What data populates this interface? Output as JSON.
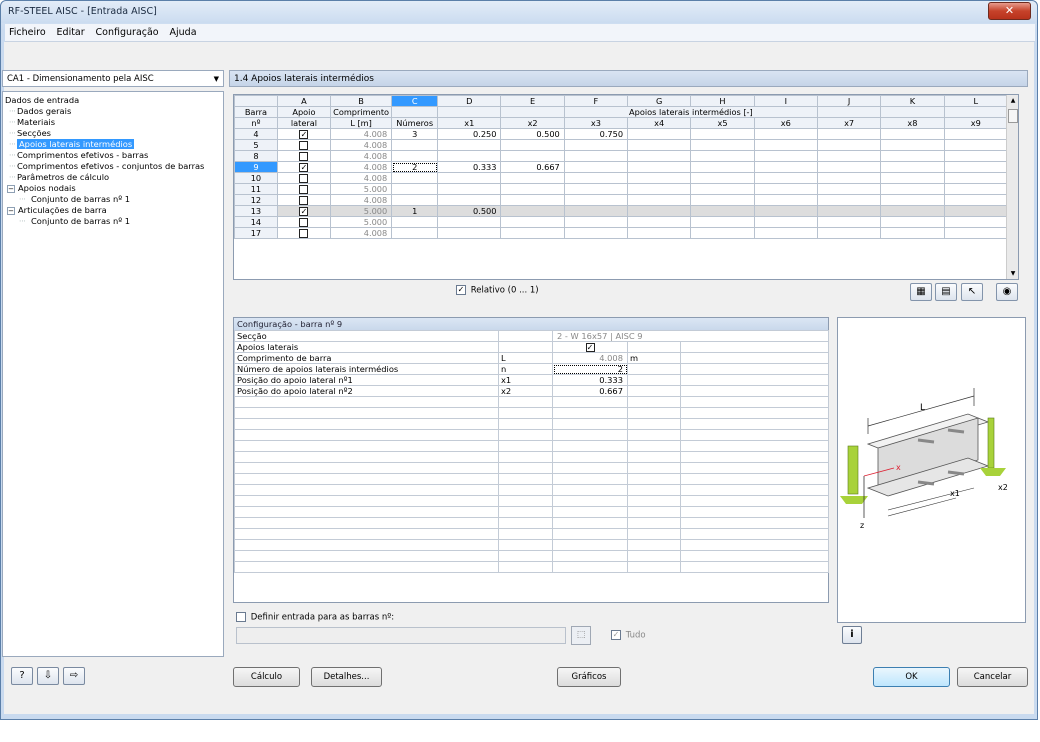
{
  "window": {
    "title": "RF-STEEL AISC - [Entrada AISC]",
    "close_glyph": "✕"
  },
  "menu": [
    "Ficheiro",
    "Editar",
    "Configuração",
    "Ajuda"
  ],
  "nav": {
    "dropdown": "CA1 - Dimensionamento pela AISC",
    "root": "Dados de entrada",
    "items": [
      {
        "label": "Dados gerais"
      },
      {
        "label": "Materiais"
      },
      {
        "label": "Secções"
      },
      {
        "label": "Apoios laterais intermédios",
        "selected": true
      },
      {
        "label": "Comprimentos efetivos - barras"
      },
      {
        "label": "Comprimentos efetivos - conjuntos de barras"
      },
      {
        "label": "Parâmetros de cálculo"
      }
    ],
    "apoios_nodais": "Apoios nodais",
    "apoios_nodais_child": "Conjunto de barras nº 1",
    "articulacoes": "Articulações de barra",
    "articulacoes_child": "Conjunto de barras nº 1",
    "collapse_glyph": "−"
  },
  "section_title": "1.4 Apoios laterais intermédios",
  "grid": {
    "col_letters": [
      "A",
      "B",
      "C",
      "D",
      "E",
      "F",
      "G",
      "H",
      "I",
      "J",
      "K",
      "L"
    ],
    "h_barra": "Barra",
    "h_barra2": "nº",
    "h_apoio": "Apoio",
    "h_apoio2": "lateral",
    "h_comp": "Comprimento",
    "h_comp2": "L [m]",
    "h_numeros": "Números",
    "h_group": "Apoios laterais intermédios [-]",
    "x_labels": [
      "x1",
      "x2",
      "x3",
      "x4",
      "x5",
      "x6",
      "x7",
      "x8",
      "x9"
    ],
    "rows": [
      {
        "barra": "4",
        "checked": true,
        "len": "4.008",
        "num": "3",
        "x1": "0.250",
        "x2": "0.500",
        "x3": "0.750"
      },
      {
        "barra": "5",
        "checked": false,
        "len": "4.008",
        "num": "",
        "x1": "",
        "x2": "",
        "x3": ""
      },
      {
        "barra": "8",
        "checked": false,
        "len": "4.008",
        "num": "",
        "x1": "",
        "x2": "",
        "x3": ""
      },
      {
        "barra": "9",
        "checked": true,
        "len": "4.008",
        "num": "2",
        "x1": "0.333",
        "x2": "0.667",
        "x3": "",
        "selected": true
      },
      {
        "barra": "10",
        "checked": false,
        "len": "4.008",
        "num": "",
        "x1": "",
        "x2": "",
        "x3": ""
      },
      {
        "barra": "11",
        "checked": false,
        "len": "5.000",
        "num": "",
        "x1": "",
        "x2": "",
        "x3": ""
      },
      {
        "barra": "12",
        "checked": false,
        "len": "4.008",
        "num": "",
        "x1": "",
        "x2": "",
        "x3": ""
      },
      {
        "barra": "13",
        "checked": true,
        "len": "5.000",
        "num": "1",
        "x1": "0.500",
        "x2": "",
        "x3": "",
        "highlight": true
      },
      {
        "barra": "14",
        "checked": false,
        "len": "5.000",
        "num": "",
        "x1": "",
        "x2": "",
        "x3": ""
      },
      {
        "barra": "17",
        "checked": false,
        "len": "4.008",
        "num": "",
        "x1": "",
        "x2": "",
        "x3": ""
      }
    ]
  },
  "relative_label": "Relativo (0 ... 1)",
  "relative_checked": true,
  "settings": {
    "title": "Configuração - barra nº 9",
    "rows": [
      {
        "label": "Secção",
        "sym": "",
        "value": "2 - W 16x57 | AISC 9",
        "unit": "",
        "kind": "section"
      },
      {
        "label": "Apoios laterais",
        "sym": "",
        "value": "☑",
        "unit": "",
        "kind": "check"
      },
      {
        "label": "Comprimento de barra",
        "sym": "L",
        "value": "4.008",
        "unit": "m",
        "kind": "grey"
      },
      {
        "label": "Número de apoios laterais intermédios",
        "sym": "n",
        "value": "2",
        "unit": "",
        "kind": "dotted"
      },
      {
        "label": "Posição do apoio lateral nº1",
        "sym": "x1",
        "value": "0.333",
        "unit": "",
        "kind": "val"
      },
      {
        "label": "Posição do apoio lateral nº2",
        "sym": "x2",
        "value": "0.667",
        "unit": "",
        "kind": "val"
      }
    ]
  },
  "define_label": "Definir entrada para as barras nº:",
  "tudo_label": "Tudo",
  "diagram": {
    "L": "L",
    "x": "x",
    "z": "z",
    "x1": "x1",
    "x2": "x2"
  },
  "buttons": {
    "calculo": "Cálculo",
    "detalhes": "Detalhes...",
    "graficos": "Gráficos",
    "ok": "OK",
    "cancelar": "Cancelar"
  },
  "colors": {
    "selection": "#3399ff",
    "support_green": "#a8d23a"
  }
}
